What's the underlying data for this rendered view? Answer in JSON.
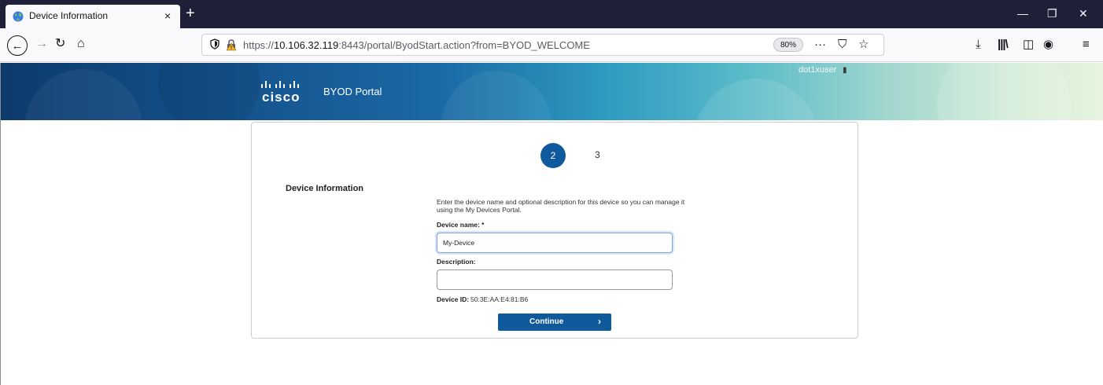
{
  "browser": {
    "tab_title": "Device Information",
    "tab_close": "×",
    "new_tab": "+",
    "url_prefix": "https://",
    "url_host": "10.106.32.119",
    "url_rest": ":8443/portal/ByodStart.action?from=BYOD_WELCOME",
    "zoom": "80%",
    "icons": {
      "back": "back-arrow-icon",
      "forward": "forward-arrow-icon",
      "reload": "reload-icon",
      "home": "home-icon",
      "shield": "tracking-shield-icon",
      "lock": "lock-warning-icon",
      "more": "ellipsis-icon",
      "pocket": "pocket-icon",
      "bookmark": "star-icon",
      "download": "download-icon",
      "library": "library-icon",
      "sidebar": "sidebar-icon",
      "account": "account-icon",
      "menu": "hamburger-menu-icon"
    }
  },
  "portal": {
    "brand": "cisco",
    "title": "BYOD Portal",
    "user": "dot1xuser",
    "colors": {
      "accent": "#0e5a9c",
      "banner_dark": "#0d3a6c",
      "banner_light": "#e6f3df"
    }
  },
  "steps": {
    "current": "2",
    "next": "3"
  },
  "form": {
    "heading": "Device Information",
    "instructions": "Enter the device name and optional description for this device so you can manage it using the My Devices Portal.",
    "device_name_label": "Device name: *",
    "device_name_value": "My-Device",
    "description_label": "Description:",
    "description_value": "",
    "device_id_label": "Device ID:",
    "device_id_value": "50:3E:AA:E4:81:B6",
    "continue_label": "Continue",
    "continue_arrow": "›"
  }
}
